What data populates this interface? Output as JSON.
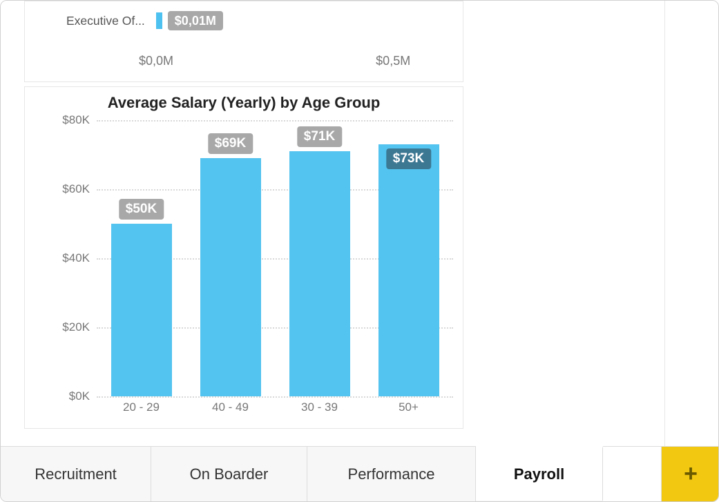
{
  "upper_chart": {
    "row_label": "Executive Of...",
    "bar_value": 0.01,
    "bar_label": "$0,01M",
    "x_ticks": [
      "$0,0M",
      "$0,5M"
    ],
    "x_tick_values": [
      0.0,
      0.5
    ]
  },
  "chart": {
    "title": "Average Salary (Yearly) by Age Group"
  },
  "chart_data": {
    "type": "bar",
    "title": "Average Salary (Yearly) by Age Group",
    "xlabel": "",
    "ylabel": "",
    "ylim": [
      0,
      80
    ],
    "y_ticks": [
      0,
      20,
      40,
      60,
      80
    ],
    "y_tick_labels": [
      "$0K",
      "$20K",
      "$40K",
      "$60K",
      "$80K"
    ],
    "categories": [
      "20 - 29",
      "40 - 49",
      "30 - 39",
      "50+"
    ],
    "values": [
      50,
      69,
      71,
      73
    ],
    "value_labels": [
      "$50K",
      "$69K",
      "$71K",
      "$73K"
    ],
    "label_styles": [
      "gray",
      "gray",
      "gray",
      "blue"
    ]
  },
  "tabs": {
    "items": [
      {
        "label": "Recruitment",
        "active": false
      },
      {
        "label": "On Boarder",
        "active": false
      },
      {
        "label": "Performance",
        "active": false
      },
      {
        "label": "Payroll",
        "active": true
      }
    ],
    "add_label": "+"
  }
}
